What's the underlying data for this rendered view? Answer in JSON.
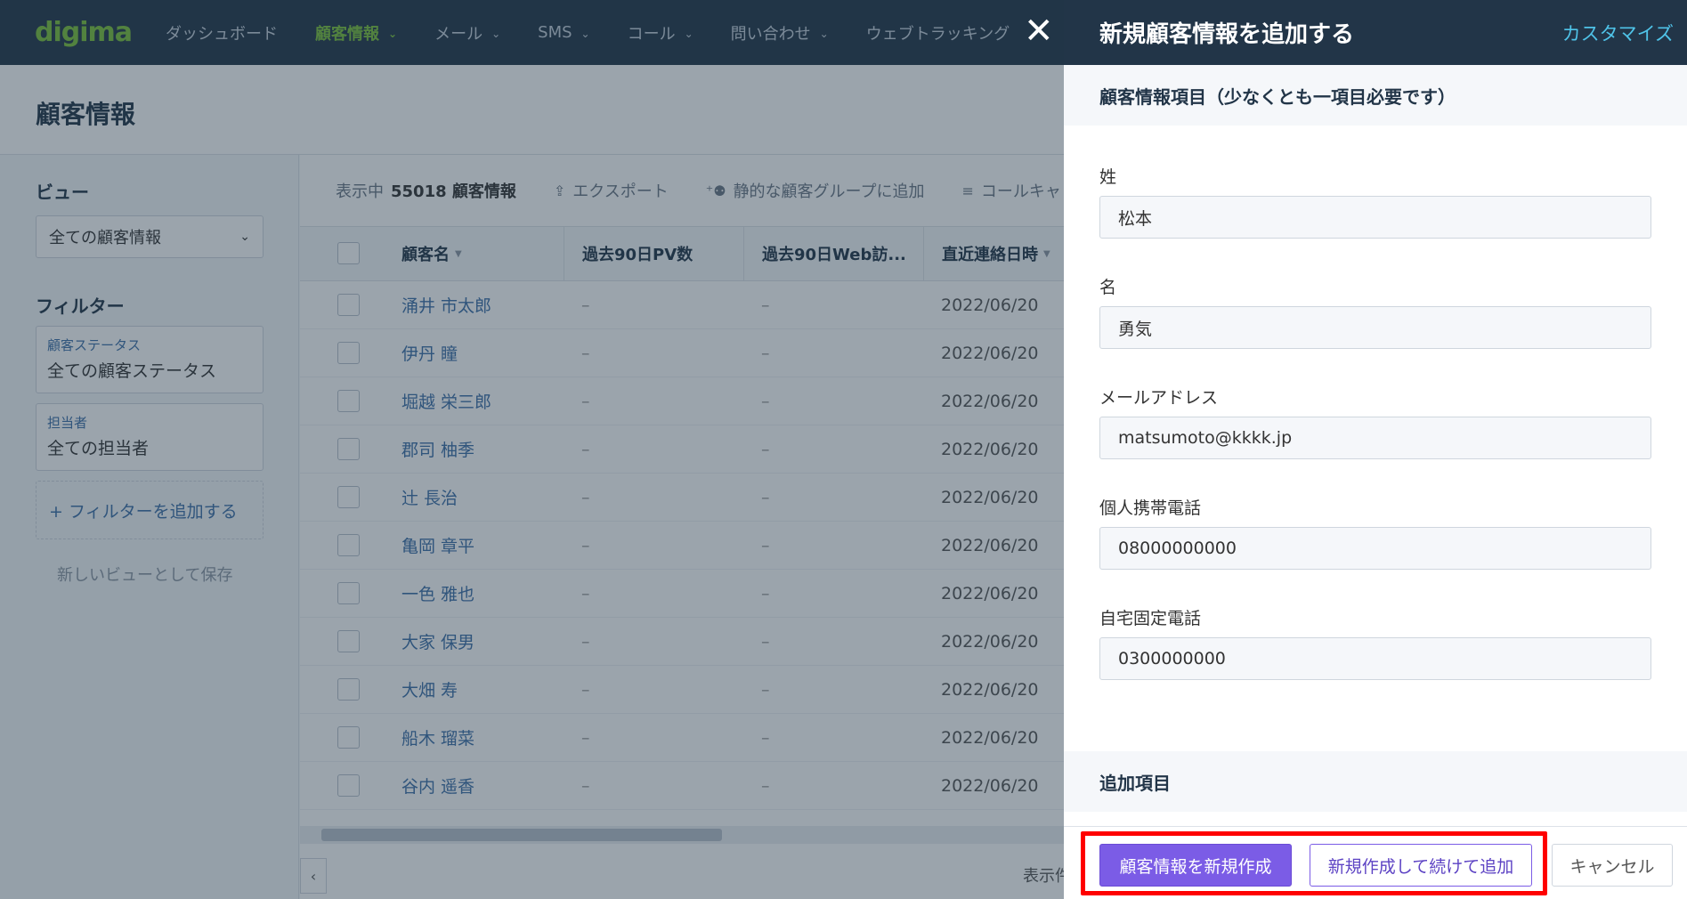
{
  "nav": {
    "logo": "digima",
    "items": [
      {
        "label": "ダッシュボード",
        "active": false,
        "chevron": false
      },
      {
        "label": "顧客情報",
        "active": true,
        "chevron": true
      },
      {
        "label": "メール",
        "active": false,
        "chevron": true
      },
      {
        "label": "SMS",
        "active": false,
        "chevron": true
      },
      {
        "label": "コール",
        "active": false,
        "chevron": true
      },
      {
        "label": "問い合わせ",
        "active": false,
        "chevron": true
      },
      {
        "label": "ウェブトラッキング",
        "active": false,
        "chevron": false
      }
    ]
  },
  "page": {
    "title": "顧客情報"
  },
  "sidebar": {
    "view_label": "ビュー",
    "view_value": "全ての顧客情報",
    "filter_label": "フィルター",
    "filters": [
      {
        "label": "顧客ステータス",
        "value": "全ての顧客ステータス"
      },
      {
        "label": "担当者",
        "value": "全ての担当者"
      }
    ],
    "add_filter": "+ フィルターを追加する",
    "save_view": "新しいビューとして保存"
  },
  "toolbar": {
    "showing": "表示中",
    "count": "55018 顧客情報",
    "export": "エクスポート",
    "add_group": "静的な顧客グループに追加",
    "call": "コールキャ"
  },
  "table": {
    "headers": [
      "顧客名",
      "過去90日PV数",
      "過去90日Web訪...",
      "直近連絡日時"
    ],
    "rows": [
      {
        "name": "涌井 市太郎",
        "pv": "–",
        "visits": "–",
        "date": "2022/06/20"
      },
      {
        "name": "伊丹 瞳",
        "pv": "–",
        "visits": "–",
        "date": "2022/06/20"
      },
      {
        "name": "堀越 栄三郎",
        "pv": "–",
        "visits": "–",
        "date": "2022/06/20"
      },
      {
        "name": "郡司 柚季",
        "pv": "–",
        "visits": "–",
        "date": "2022/06/20"
      },
      {
        "name": "辻 長治",
        "pv": "–",
        "visits": "–",
        "date": "2022/06/20"
      },
      {
        "name": "亀岡 章平",
        "pv": "–",
        "visits": "–",
        "date": "2022/06/20"
      },
      {
        "name": "一色 雅也",
        "pv": "–",
        "visits": "–",
        "date": "2022/06/20"
      },
      {
        "name": "大家 保男",
        "pv": "–",
        "visits": "–",
        "date": "2022/06/20"
      },
      {
        "name": "大畑 寿",
        "pv": "–",
        "visits": "–",
        "date": "2022/06/20"
      },
      {
        "name": "船木 瑠菜",
        "pv": "–",
        "visits": "–",
        "date": "2022/06/20"
      },
      {
        "name": "谷内 遥香",
        "pv": "–",
        "visits": "–",
        "date": "2022/06/20"
      }
    ],
    "pager_text": "表示件"
  },
  "drawer": {
    "title": "新規顧客情報を追加する",
    "customize": "カスタマイズ",
    "section_main": "顧客情報項目（少なくとも一項目必要です）",
    "fields": [
      {
        "label": "姓",
        "value": "松本"
      },
      {
        "label": "名",
        "value": "勇気"
      },
      {
        "label": "メールアドレス",
        "value": "matsumoto@kkkk.jp"
      },
      {
        "label": "個人携帯電話",
        "value": "08000000000"
      },
      {
        "label": "自宅固定電話",
        "value": "0300000000"
      }
    ],
    "section_extra": "追加項目",
    "buttons": {
      "create": "顧客情報を新規作成",
      "create_continue": "新規作成して続けて追加",
      "cancel": "キャンセル"
    }
  },
  "colors": {
    "nav_bg": "#223548",
    "active_green": "#7bc23a",
    "link_blue": "#3c6fa8",
    "primary_purple": "#7b5ce6",
    "highlight_red": "#ff0000",
    "customize_cyan": "#4fc3e8"
  }
}
